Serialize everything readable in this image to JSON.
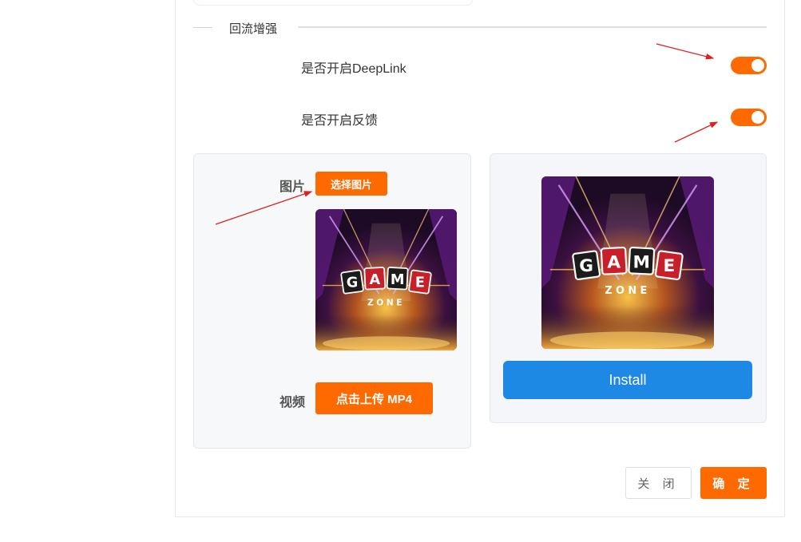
{
  "section": {
    "title": "回流增强"
  },
  "toggles": [
    {
      "label": "是否开启DeepLink",
      "on": true
    },
    {
      "label": "是否开启反馈",
      "on": true
    }
  ],
  "upload": {
    "image_label": "图片",
    "choose_image_button": "选择图片",
    "video_label": "视频",
    "upload_mp4_button": "点击上传 MP4"
  },
  "preview": {
    "logo_letters": [
      "G",
      "A",
      "M",
      "E"
    ],
    "logo_sub": "ZONE",
    "install_button": "Install"
  },
  "footer": {
    "close_button": "关 闭",
    "confirm_button": "确 定"
  },
  "colors": {
    "accent": "#ff6a00",
    "install_blue": "#1e88e5",
    "annotation_red": "#e02020"
  }
}
